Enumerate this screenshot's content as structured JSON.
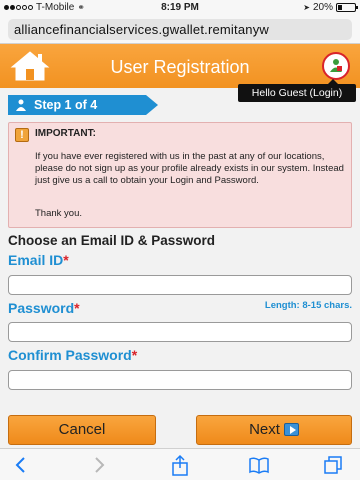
{
  "status_bar": {
    "carrier": "T-Mobile",
    "time": "8:19 PM",
    "battery": "20%"
  },
  "browser": {
    "url": "alliancefinancialservices.gwallet.remitanyw"
  },
  "header": {
    "title": "User Registration",
    "login_tooltip": "Hello Guest (Login)"
  },
  "step": {
    "label": "Step 1 of 4"
  },
  "notice": {
    "title": "IMPORTANT:",
    "body": "If you have ever registered with us in the past at any of our locations, please do not sign up as your profile already exists in our system. Instead just give us a call to obtain your Login and Password.",
    "closing": "Thank you."
  },
  "form": {
    "section_title": "Choose an Email ID & Password",
    "required_marker": "*",
    "email": {
      "label": "Email ID",
      "value": "",
      "placeholder": ""
    },
    "password": {
      "label": "Password",
      "hint": "Length: 8-15 chars.",
      "value": "",
      "placeholder": ""
    },
    "confirm_password": {
      "label": "Confirm Password",
      "value": "",
      "placeholder": ""
    }
  },
  "buttons": {
    "cancel": "Cancel",
    "next": "Next"
  },
  "colors": {
    "header_orange": "#f29221",
    "accent_blue": "#1f8fd2",
    "required_red": "#d9232a",
    "notice_bg": "#f8dede"
  }
}
